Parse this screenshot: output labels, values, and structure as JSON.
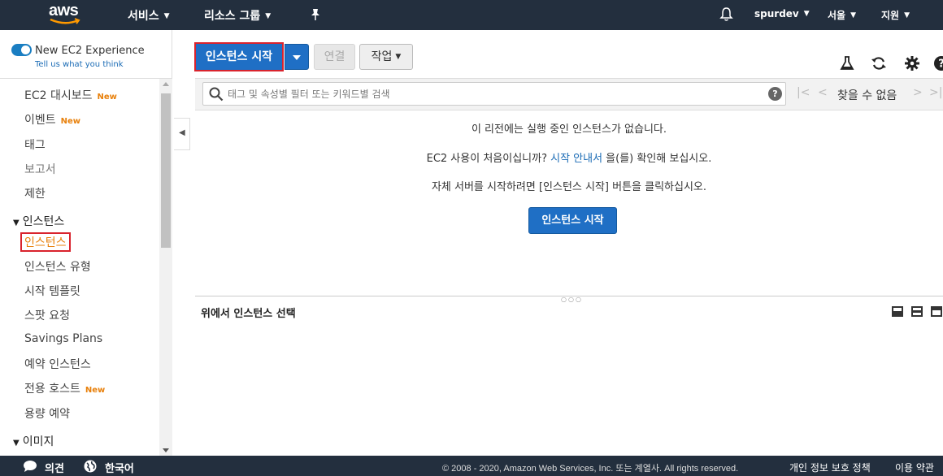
{
  "topnav": {
    "logo_text": "aws",
    "services": "서비스",
    "resource_groups": "리소스 그룹",
    "user": "spurdev",
    "region": "서울",
    "support": "지원"
  },
  "sidebar": {
    "experience_label": "New EC2 Experience",
    "feedback_link": "Tell us what you think",
    "items": [
      {
        "label": "EC2 대시보드",
        "badge": "New"
      },
      {
        "label": "이벤트",
        "badge": "New"
      },
      {
        "label": "태그"
      },
      {
        "label": "보고서"
      },
      {
        "label": "제한"
      }
    ],
    "section_instances": "인스턴스",
    "instances_items": [
      {
        "label": "인스턴스"
      },
      {
        "label": "인스턴스 유형"
      },
      {
        "label": "시작 템플릿"
      },
      {
        "label": "스팟 요청"
      },
      {
        "label": "Savings Plans"
      },
      {
        "label": "예약 인스턴스"
      },
      {
        "label": "전용 호스트",
        "badge": "New"
      },
      {
        "label": "용량 예약"
      }
    ],
    "section_images": "이미지"
  },
  "toolbar": {
    "launch": "인스턴스 시작",
    "connect": "연결",
    "actions": "작업"
  },
  "search": {
    "placeholder": "태그 및 속성별 필터 또는 키워드별 검색",
    "pager_text": "찾을 수 없음"
  },
  "empty_state": {
    "line1": "이 리전에는 실행 중인 인스턴스가 없습니다.",
    "line2_pre": "EC2 사용이 처음이십니까? ",
    "line2_link": "시작 안내서",
    "line2_post": " 을(를) 확인해 보십시오.",
    "line3": "자체 서버를 시작하려면 [인스턴스 시작] 버튼을 클릭하십시오.",
    "launch": "인스턴스 시작"
  },
  "detail": {
    "title": "위에서 인스턴스 선택"
  },
  "footer": {
    "feedback": "의견",
    "language": "한국어",
    "copyright": "© 2008 - 2020, Amazon Web Services, Inc. 또는 계열사. All rights reserved.",
    "privacy": "개인 정보 보호 정책",
    "terms": "이용 약관"
  },
  "colors": {
    "nav_bg": "#232f3e",
    "primary": "#1f6fc5",
    "new_badge": "#e8800b",
    "highlight_border": "#d9232d"
  }
}
